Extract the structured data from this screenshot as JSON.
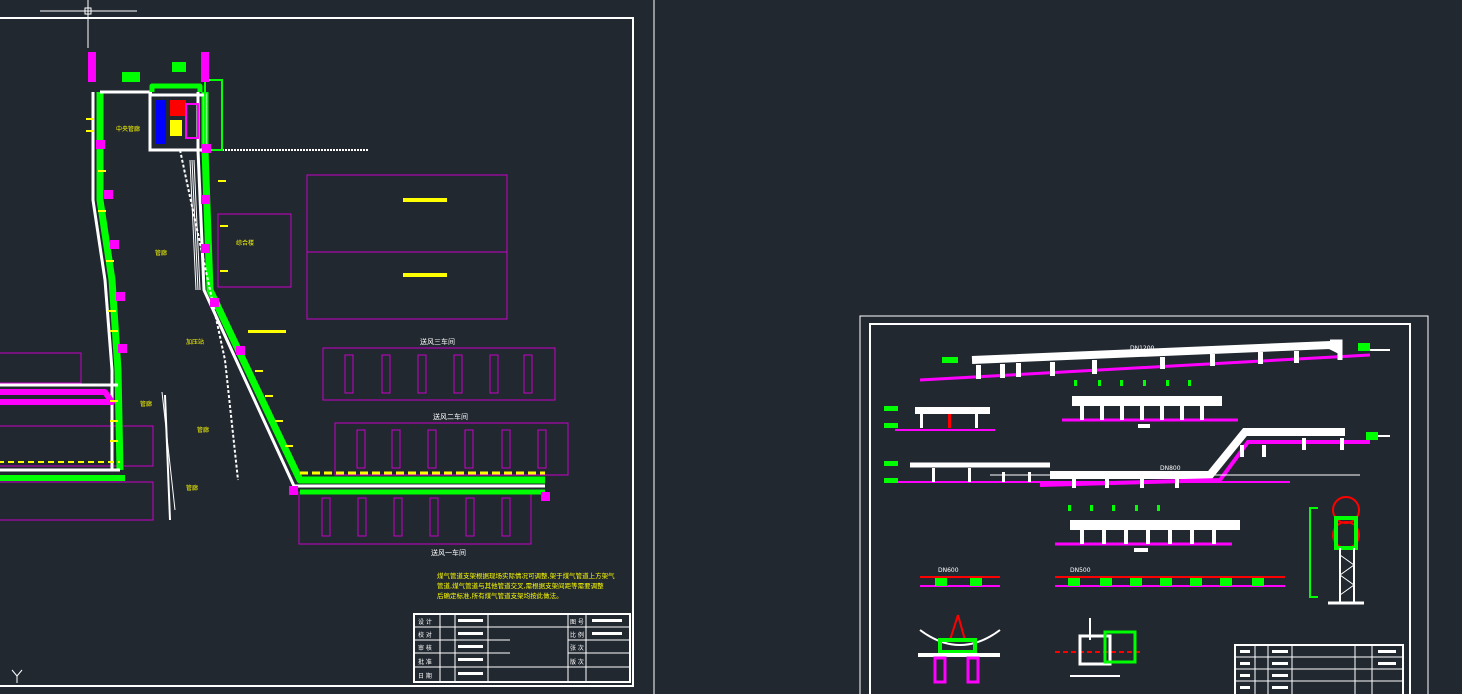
{
  "workshops": {
    "w3": "送风三车间",
    "w2": "送风二车间",
    "w1": "送风一车间"
  },
  "side_labels": {
    "a": "加压站",
    "b": "中央管廊",
    "c": "管廊",
    "d": "综合楼",
    "e": "管廊",
    "f": "管廊",
    "g": "泵房",
    "h": "管廊"
  },
  "note_lines": [
    "煤气管道支架根据现场实际情况可调整,架于煤气管道上方架气",
    "管道,煤气管道与其他管道交叉,需根据支架间距等需要调整",
    "后确定标准,所有煤气管道支架均按此做法。"
  ],
  "titleblock_left": {
    "rows": [
      "设 计",
      "校 对",
      "审 核",
      "批 准",
      "日 期"
    ],
    "right": [
      "图 号",
      "比 例",
      "张 次",
      "版 次"
    ]
  },
  "detail_labels": {
    "top": "DN1200",
    "mid": "DN800",
    "cross1": "DN600",
    "cross2": "DN500"
  },
  "colors": {
    "background": "#212830",
    "white": "#ffffff",
    "green": "#00ff00",
    "magenta": "#ff00ff",
    "yellow": "#ffff00",
    "red": "#ff0000",
    "blue": "#0000ff",
    "purple": "#cc00cc"
  },
  "icons": [
    "ucs-axis-icon",
    "crosshair-cursor-icon"
  ]
}
